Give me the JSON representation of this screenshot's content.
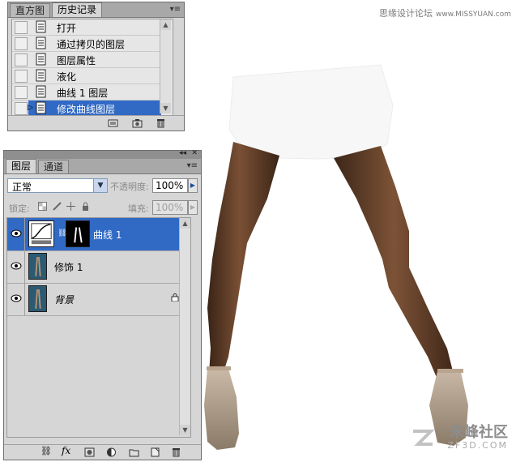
{
  "history_panel": {
    "tabs": [
      {
        "label": "直方图",
        "active": false
      },
      {
        "label": "历史记录",
        "active": true
      }
    ],
    "items": [
      {
        "label": "打开",
        "selected": false
      },
      {
        "label": "通过拷贝的图层",
        "selected": false
      },
      {
        "label": "图层属性",
        "selected": false
      },
      {
        "label": "液化",
        "selected": false
      },
      {
        "label": "曲线 1 图层",
        "selected": false
      },
      {
        "label": "修改曲线图层",
        "selected": true
      }
    ],
    "menu_icon": "panel-menu-icon",
    "footer_icons": [
      "new-document-from-state-icon",
      "snapshot-camera-icon",
      "trash-icon"
    ]
  },
  "layers_panel": {
    "tabs": [
      {
        "label": "图层",
        "active": true
      },
      {
        "label": "通道",
        "active": false
      }
    ],
    "blend_mode": "正常",
    "opacity_label": "不透明度:",
    "opacity_value": "100%",
    "lock_label": "锁定:",
    "fill_label": "填充:",
    "fill_value": "100%",
    "layers": [
      {
        "name": "曲线 1",
        "visible": true,
        "selected": true,
        "type": "adjustment",
        "locked": false
      },
      {
        "name": "修饰 1",
        "visible": true,
        "selected": false,
        "type": "image",
        "locked": false
      },
      {
        "name": "背景",
        "visible": true,
        "selected": false,
        "type": "image",
        "locked": true
      }
    ],
    "footer_icons": [
      "link-layers-icon",
      "layer-style-fx-icon",
      "add-mask-icon",
      "adjustment-layer-icon",
      "new-group-folder-icon",
      "new-layer-icon",
      "trash-icon"
    ],
    "fx_label": "fx"
  },
  "watermarks": {
    "top_cn": "思缘设计论坛",
    "top_url": "www.MISSYUAN.com",
    "bottom_cn": "朱峰社区",
    "bottom_en": "ZF3D.COM"
  },
  "colors": {
    "selection": "#316ac5",
    "panel_bg": "#d6d6d6",
    "skin": "#5b3a24"
  }
}
